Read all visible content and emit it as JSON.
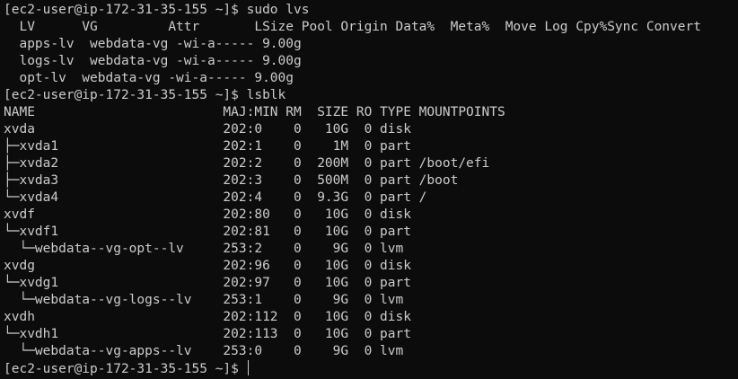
{
  "terminal": {
    "colors": {
      "background": "#0c0c0c",
      "foreground": "#cccccc"
    },
    "lines": [
      "[ec2-user@ip-172-31-35-155 ~]$ sudo lvs",
      "  LV      VG         Attr       LSize Pool Origin Data%  Meta%  Move Log Cpy%Sync Convert",
      "  apps-lv  webdata-vg -wi-a----- 9.00g",
      "  logs-lv  webdata-vg -wi-a----- 9.00g",
      "  opt-lv  webdata-vg -wi-a----- 9.00g",
      "[ec2-user@ip-172-31-35-155 ~]$ lsblk",
      "NAME                        MAJ:MIN RM  SIZE RO TYPE MOUNTPOINTS",
      "xvda                        202:0    0   10G  0 disk",
      "├─xvda1                     202:1    0    1M  0 part",
      "├─xvda2                     202:2    0  200M  0 part /boot/efi",
      "├─xvda3                     202:3    0  500M  0 part /boot",
      "└─xvda4                     202:4    0  9.3G  0 part /",
      "xvdf                        202:80   0   10G  0 disk",
      "└─xvdf1                     202:81   0   10G  0 part",
      "  └─webdata--vg-opt--lv     253:2    0    9G  0 lvm",
      "xvdg                        202:96   0   10G  0 disk",
      "└─xvdg1                     202:97   0   10G  0 part",
      "  └─webdata--vg-logs--lv    253:1    0    9G  0 lvm",
      "xvdh                        202:112  0   10G  0 disk",
      "└─xvdh1                     202:113  0   10G  0 part",
      "  └─webdata--vg-apps--lv    253:0    0    9G  0 lvm"
    ],
    "prompt": "[ec2-user@ip-172-31-35-155 ~]$ "
  }
}
